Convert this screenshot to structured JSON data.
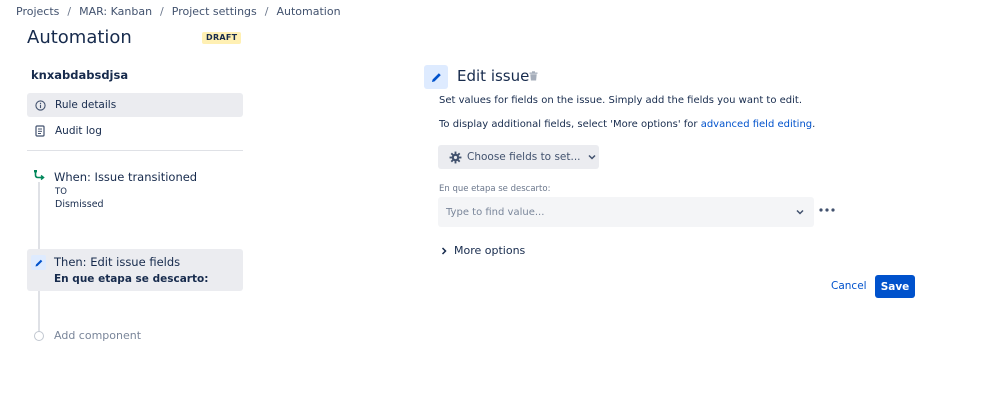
{
  "breadcrumb": [
    "Projects",
    "MAR: Kanban",
    "Project settings",
    "Automation"
  ],
  "header": {
    "title": "Automation",
    "badge": "DRAFT"
  },
  "sidebar": {
    "rule_name": "knxabdabsdjsa",
    "items": [
      {
        "label": "Rule details",
        "icon": "info-icon"
      },
      {
        "label": "Audit log",
        "icon": "document-icon"
      }
    ],
    "components": {
      "trigger": {
        "title": "When: Issue transitioned",
        "sub_label": "TO",
        "sub_value": "Dismissed",
        "icon": "transition-icon",
        "color": "#00875A"
      },
      "action": {
        "title": "Then: Edit issue fields",
        "sub": "En que etapa se descarto:",
        "icon": "pencil-icon"
      },
      "add": {
        "label": "Add component"
      }
    }
  },
  "panel": {
    "title": "Edit issue",
    "desc1": "Set values for fields on the issue. Simply add the fields you want to edit.",
    "desc2_prefix": "To display additional fields, select 'More options' for ",
    "desc2_link": "advanced field editing",
    "desc2_suffix": ".",
    "choose_fields": "Choose fields to set...",
    "field": {
      "label": "En que etapa se descarto:",
      "placeholder": "Type to find value..."
    },
    "more_options": "More options",
    "cancel": "Cancel",
    "save": "Save"
  },
  "colors": {
    "primary": "#0052CC",
    "draft_badge": "#FFF0B3",
    "trigger": "#00875A"
  }
}
